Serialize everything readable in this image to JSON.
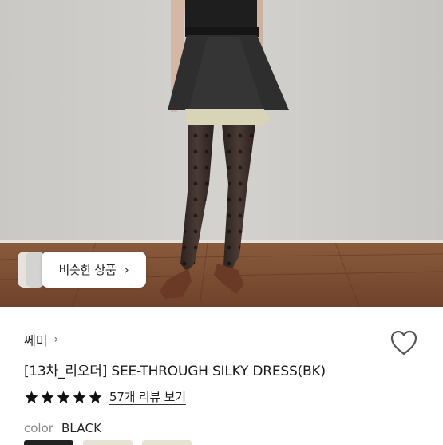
{
  "similar_button": {
    "label": "비슷한 상품",
    "chevron": "›"
  },
  "shop": {
    "name": "쎄미",
    "chevron": "›"
  },
  "product": {
    "title": "[13차_리오더] SEE-THROUGH SILKY DRESS(BK)",
    "rating_stars": 5,
    "review_link": "57개 리뷰 보기",
    "color_label": "color",
    "color_value": "BLACK"
  },
  "icons": {
    "heart": "heart-outline-icon",
    "star": "star-icon",
    "chevron": "chevron-right-icon"
  },
  "colors": {
    "star": "#111111",
    "swatch_selected": "#222222",
    "swatch_other": "#e8e2d4"
  }
}
